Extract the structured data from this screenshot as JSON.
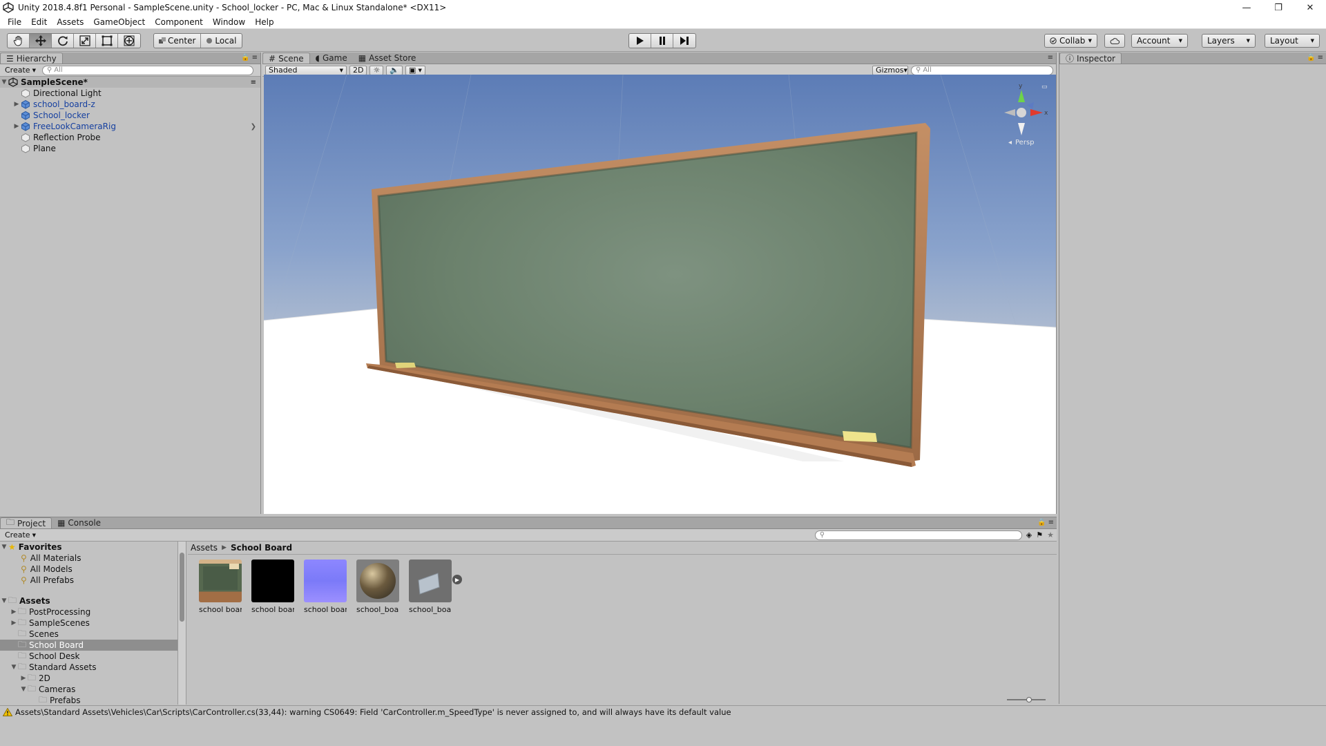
{
  "window": {
    "title": "Unity 2018.4.8f1 Personal - SampleScene.unity - School_locker - PC, Mac & Linux Standalone* <DX11>"
  },
  "menu": [
    "File",
    "Edit",
    "Assets",
    "GameObject",
    "Component",
    "Window",
    "Help"
  ],
  "toolbar": {
    "pivot_center": "Center",
    "pivot_local": "Local",
    "collab": "Collab",
    "account": "Account",
    "layers": "Layers",
    "layout": "Layout"
  },
  "hierarchy": {
    "tab": "Hierarchy",
    "create": "Create",
    "search_placeholder": "All",
    "scene": "SampleScene*",
    "items": [
      {
        "label": "Directional Light"
      },
      {
        "label": "school_board-z"
      },
      {
        "label": "School_locker"
      },
      {
        "label": "FreeLookCameraRig"
      },
      {
        "label": "Reflection Probe"
      },
      {
        "label": "Plane"
      }
    ]
  },
  "scene_tabs": {
    "scene": "Scene",
    "game": "Game",
    "asset_store": "Asset Store"
  },
  "scene_toolbar": {
    "shading": "Shaded",
    "mode_2d": "2D",
    "gizmos": "Gizmos",
    "search_placeholder": "All",
    "persp": "Persp",
    "gizmo_axes": {
      "y": "y",
      "x": "x"
    }
  },
  "inspector": {
    "tab": "Inspector"
  },
  "project": {
    "tab_project": "Project",
    "tab_console": "Console",
    "create": "Create",
    "favorites": {
      "label": "Favorites",
      "items": [
        "All Materials",
        "All Models",
        "All Prefabs"
      ]
    },
    "assets": {
      "label": "Assets",
      "items": [
        "PostProcessing",
        "SampleScenes",
        "Scenes",
        "School Board",
        "School Desk",
        "Standard Assets",
        "2D",
        "Cameras",
        "Prefabs"
      ]
    },
    "breadcrumb": {
      "root": "Assets",
      "current": "School Board"
    },
    "files": [
      {
        "label": "school boar...",
        "kind": "albedo"
      },
      {
        "label": "school boar...",
        "kind": "black"
      },
      {
        "label": "school boar...",
        "kind": "normal"
      },
      {
        "label": "school_boa...",
        "kind": "material"
      },
      {
        "label": "school_boa...",
        "kind": "mesh"
      }
    ]
  },
  "status": {
    "message": "Assets\\Standard Assets\\Vehicles\\Car\\Scripts\\CarController.cs(33,44): warning CS0649: Field 'CarController.m_SpeedType' is never assigned to, and will always have its default value"
  },
  "colors": {
    "editor_bg": "#c2c2c2",
    "prefab_text": "#1640a0",
    "selection": "#8e8e8e",
    "chalkboard": "#6f8570",
    "frame_wood": "#b07a52",
    "sky_top": "#5f7fb8",
    "ground": "#ffffff"
  }
}
